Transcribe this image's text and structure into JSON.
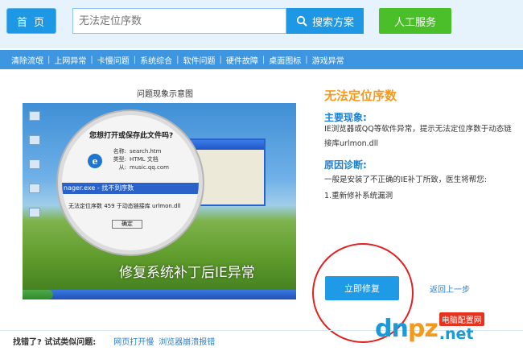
{
  "header": {
    "home_label": "首 页",
    "search_placeholder": "无法定位序数",
    "search_button": "搜索方案",
    "human_service": "人工服务"
  },
  "nav": {
    "items": [
      "清除流氓",
      "上网异常",
      "卡慢问题",
      "系统综合",
      "软件问题",
      "硬件故障",
      "桌面图标",
      "游戏异常"
    ]
  },
  "demo": {
    "title": "问题现象示意图",
    "dialog_title": "您想打开或保存此文件吗?",
    "fields": [
      {
        "k": "名称:",
        "v": "search.htm"
      },
      {
        "k": "类型:",
        "v": "HTML 文档"
      },
      {
        "k": "从:",
        "v": "music.qq.com"
      }
    ],
    "error_bar": "nager.exe - 找不到序数",
    "error_message": "无法定位序数 459 于动态链接库 urlmon.dll",
    "ok_button": "确定",
    "caption": "修复系统补丁后IE异常"
  },
  "info": {
    "title": "无法定位序数",
    "symptom_heading": "主要现象:",
    "symptom_text": "IE浏览器或QQ等软件异常，提示无法定位序数于动态链接库urlmon.dll",
    "diagnosis_heading": "原因诊断:",
    "diagnosis_text": "一般是安装了不正确的IE补丁所致，医生将帮您:",
    "diagnosis_step": "1.重新修补系统漏洞",
    "fix_button": "立即修复",
    "back_link": "返回上一步"
  },
  "bottom": {
    "label": "找错了? 试试类似问题:",
    "links": [
      "网页打开慢",
      "浏览器崩溃报错"
    ]
  },
  "watermark": {
    "logo_left": "dn",
    "logo_mid": "pz",
    "cn": "电脑配置网",
    "net": ".net"
  },
  "colors": {
    "primary_blue": "#1e97e5",
    "green": "#4bbf2a",
    "orange_title": "#f39a1c",
    "heading_blue": "#1e7fd0",
    "highlight_red": "#e32020"
  },
  "icons": [
    "search-icon",
    "ie-icon"
  ]
}
